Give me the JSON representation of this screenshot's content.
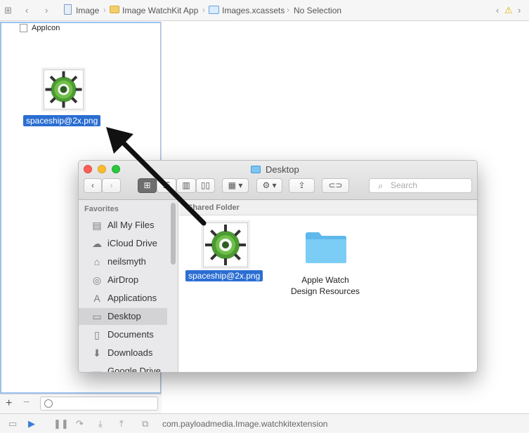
{
  "breadcrumb": {
    "items": [
      "Image",
      "Image WatchKit App",
      "Images.xcassets",
      "No Selection"
    ]
  },
  "asset_list": {
    "appicon_label": "AppIcon",
    "dropped_file": "spaceship@2x.png"
  },
  "finder": {
    "title": "Desktop",
    "search_placeholder": "Search",
    "favorites_header": "Favorites",
    "sidebar_items": [
      {
        "label": "All My Files",
        "icon": "all-files-icon"
      },
      {
        "label": "iCloud Drive",
        "icon": "cloud-icon"
      },
      {
        "label": "neilsmyth",
        "icon": "home-icon"
      },
      {
        "label": "AirDrop",
        "icon": "airdrop-icon"
      },
      {
        "label": "Applications",
        "icon": "applications-icon"
      },
      {
        "label": "Desktop",
        "icon": "desktop-icon",
        "selected": true
      },
      {
        "label": "Documents",
        "icon": "documents-icon"
      },
      {
        "label": "Downloads",
        "icon": "downloads-icon"
      },
      {
        "label": "Google Drive",
        "icon": "folder-icon"
      }
    ],
    "section_header": "Shared Folder",
    "files": [
      {
        "label": "spaceship@2x.png",
        "selected": true
      },
      {
        "label_line1": "Apple Watch",
        "label_line2": "Design Resources"
      }
    ]
  },
  "debug_bar": {
    "target": "com.payloadmedia.Image.watchkitextension"
  },
  "colors": {
    "selection": "#2b6ed2",
    "panel_border": "#9cc1ec",
    "folder_blue": "#6cc4f4"
  }
}
